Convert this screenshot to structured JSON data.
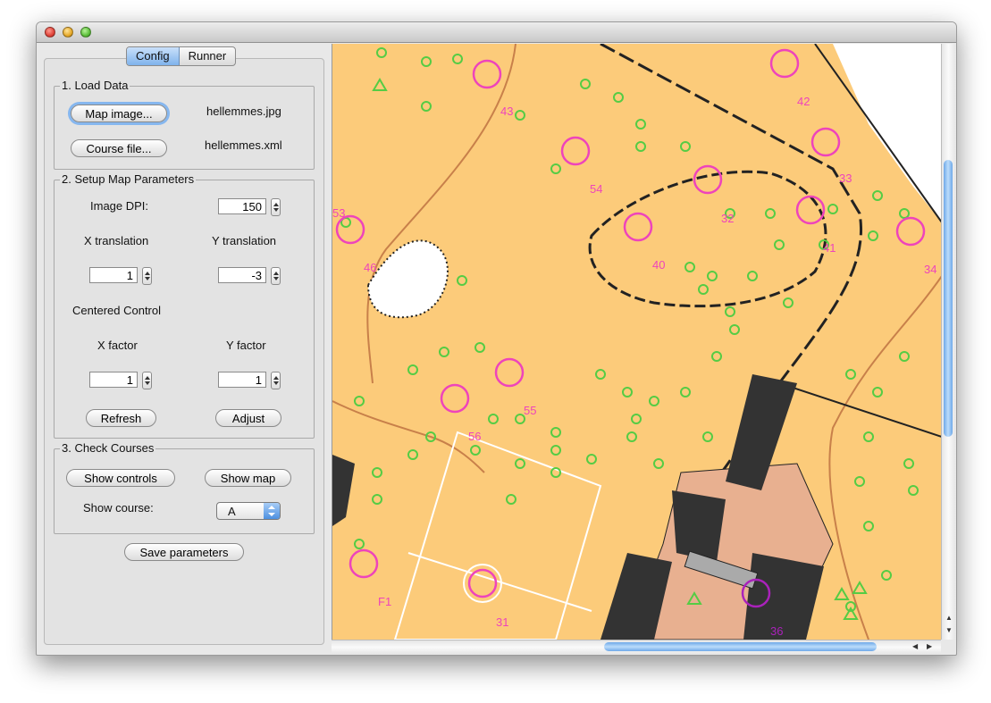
{
  "tabs": [
    {
      "label": "Config"
    },
    {
      "label": "Runner"
    }
  ],
  "load_data": {
    "title": "1. Load Data",
    "map_button": "Map image...",
    "map_file": "hellemmes.jpg",
    "course_button": "Course file...",
    "course_file": "hellemmes.xml"
  },
  "map_params": {
    "title": "2. Setup Map Parameters",
    "dpi_label": "Image DPI:",
    "dpi_value": "150",
    "xt_label": "X translation",
    "yt_label": "Y translation",
    "xt_value": "1",
    "yt_value": "-3",
    "centered_label": "Centered Control",
    "xf_label": "X factor",
    "yf_label": "Y factor",
    "xf_value": "1",
    "yf_value": "1",
    "refresh_button": "Refresh",
    "adjust_button": "Adjust"
  },
  "check": {
    "title": "3. Check Courses",
    "controls_button": "Show controls",
    "map_button": "Show map",
    "course_label": "Show course:",
    "course_value": "A"
  },
  "save_button": "Save parameters",
  "map": {
    "labels": [
      "43",
      "42",
      "54",
      "32",
      "33",
      "53",
      "41",
      "46",
      "40",
      "34",
      "55",
      "56",
      "F1",
      "31",
      "36"
    ]
  },
  "colors": {
    "map_bg": "#fccb7a",
    "control": "#ee44bb",
    "selected": "#aa22bb",
    "green": "#55cc44",
    "building": "#333333",
    "paved": "#e8b090",
    "accent": "#6aa6ea"
  },
  "icons": {
    "close": "close-icon",
    "minimize": "minimize-icon",
    "zoom": "zoom-icon"
  }
}
